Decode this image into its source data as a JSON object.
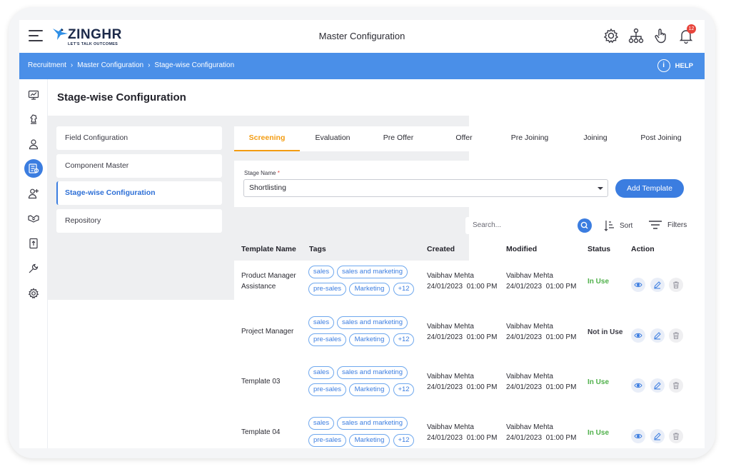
{
  "header": {
    "logo_text": "ZINGHR",
    "logo_tagline": "LET'S TALK OUTCOMES",
    "title": "Master Configuration",
    "notification_count": "12"
  },
  "breadcrumb": [
    "Recruitment",
    "Master Configuration",
    "Stage-wise Configuration"
  ],
  "help_label": "HELP",
  "page_title": "Stage-wise Configuration",
  "left_menu": [
    "Field Configuration",
    "Component Master",
    "Stage-wise Configuration",
    "Repository"
  ],
  "tabs": [
    "Screening",
    "Evaluation",
    "Pre Offer",
    "Offer",
    "Pre Joining",
    "Joining",
    "Post Joining"
  ],
  "stage": {
    "label": "Stage Name",
    "required_mark": "*",
    "value": "Shortlisting"
  },
  "add_template_label": "Add Template",
  "search_placeholder": "Search...",
  "sort_label": "Sort",
  "filters_label": "Filters",
  "columns": [
    "Template Name",
    "Tags",
    "Created",
    "Modified",
    "Status",
    "Action"
  ],
  "tags": [
    "sales",
    "sales and marketing",
    "pre-sales",
    "Marketing",
    "+12"
  ],
  "rows": [
    {
      "name_line1": "Product Manager",
      "name_line2": "Assistance",
      "created_by": "Vaibhav Mehta",
      "created_at": "24/01/2023  01:00 PM",
      "modified_by": "Vaibhav Mehta",
      "modified_at": "24/01/2023  01:00 PM",
      "status": "In Use"
    },
    {
      "name_line1": "Project Manager",
      "name_line2": "",
      "created_by": "Vaibhav Mehta",
      "created_at": "24/01/2023  01:00 PM",
      "modified_by": "Vaibhav Mehta",
      "modified_at": "24/01/2023  01:00 PM",
      "status": "Not in Use"
    },
    {
      "name_line1": "Template 03",
      "name_line2": "",
      "created_by": "Vaibhav Mehta",
      "created_at": "24/01/2023  01:00 PM",
      "modified_by": "Vaibhav Mehta",
      "modified_at": "24/01/2023  01:00 PM",
      "status": "In Use"
    },
    {
      "name_line1": "Template 04",
      "name_line2": "",
      "created_by": "Vaibhav Mehta",
      "created_at": "24/01/2023  01:00 PM",
      "modified_by": "Vaibhav Mehta",
      "modified_at": "24/01/2023  01:00 PM",
      "status": "In Use"
    }
  ],
  "colors": {
    "accent_blue": "#3b7de0",
    "crumb_bar": "#4a8fe8",
    "active_tab": "#f39c12",
    "in_use": "#4fb04a"
  }
}
